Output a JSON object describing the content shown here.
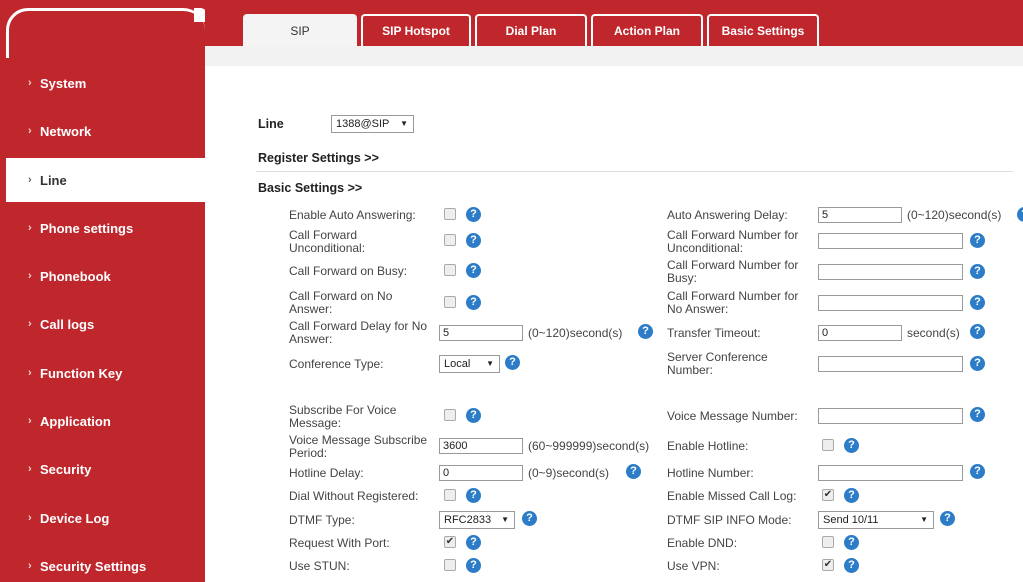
{
  "tabs": [
    "SIP",
    "SIP Hotspot",
    "Dial Plan",
    "Action Plan",
    "Basic Settings"
  ],
  "sidebar": [
    "System",
    "Network",
    "Line",
    "Phone settings",
    "Phonebook",
    "Call logs",
    "Function Key",
    "Application",
    "Security",
    "Device Log",
    "Security Settings"
  ],
  "line": {
    "label": "Line",
    "value": "1388@SIP"
  },
  "sections": {
    "register": "Register Settings >>",
    "basic": "Basic Settings >>"
  },
  "left": {
    "auto_answer": "Enable Auto Answering:",
    "cf_uncond": [
      "Call Forward",
      "Unconditional:"
    ],
    "cf_busy": "Call Forward on Busy:",
    "cf_noans": [
      "Call Forward on No",
      "Answer:"
    ],
    "cf_delay": [
      "Call Forward Delay for No",
      "Answer:"
    ],
    "cf_delay_value": "5",
    "cf_delay_unit": "(0~120)second(s)",
    "conf_type": "Conference Type:",
    "conf_type_value": "Local",
    "subscribe_vm": [
      "Subscribe For Voice",
      "Message:"
    ],
    "vm_period": [
      "Voice Message Subscribe",
      "Period:"
    ],
    "vm_period_value": "3600",
    "vm_period_unit": "(60~999999)second(s)",
    "hotline_delay": "Hotline Delay:",
    "hotline_delay_value": "0",
    "hotline_delay_unit": "(0~9)second(s)",
    "dial_without_reg": "Dial Without Registered:",
    "dtmf_type": "DTMF Type:",
    "dtmf_type_value": "RFC2833",
    "request_port": "Request With Port:",
    "use_stun": "Use STUN:"
  },
  "right": {
    "auto_answer_delay": "Auto Answering Delay:",
    "auto_answer_delay_value": "5",
    "auto_answer_delay_unit": "(0~120)second(s)",
    "cf_num_uncond": [
      "Call Forward Number for",
      "Unconditional:"
    ],
    "cf_num_busy": [
      "Call Forward Number for",
      "Busy:"
    ],
    "cf_num_noans": [
      "Call Forward Number for",
      "No Answer:"
    ],
    "transfer_timeout": "Transfer Timeout:",
    "transfer_timeout_value": "0",
    "transfer_timeout_unit": "second(s)",
    "server_conf": [
      "Server Conference",
      "Number:"
    ],
    "vm_number": "Voice Message Number:",
    "enable_hotline": "Enable Hotline:",
    "hotline_number": "Hotline Number:",
    "missed_call_log": "Enable Missed Call Log:",
    "dtmf_sip_info": "DTMF SIP INFO Mode:",
    "dtmf_sip_info_value": "Send 10/11",
    "enable_dnd": "Enable DND:",
    "use_vpn": "Use VPN:"
  },
  "checks": {
    "auto_answer": false,
    "cf_uncond": false,
    "cf_busy": false,
    "cf_noans": false,
    "subscribe_vm": false,
    "enable_hotline": false,
    "dial_without_reg": false,
    "missed_call_log": true,
    "request_port": true,
    "enable_dnd": false,
    "use_stun": false,
    "use_vpn": true
  },
  "colors": {
    "brand": "#c0272d",
    "help": "#2c7cc7"
  }
}
